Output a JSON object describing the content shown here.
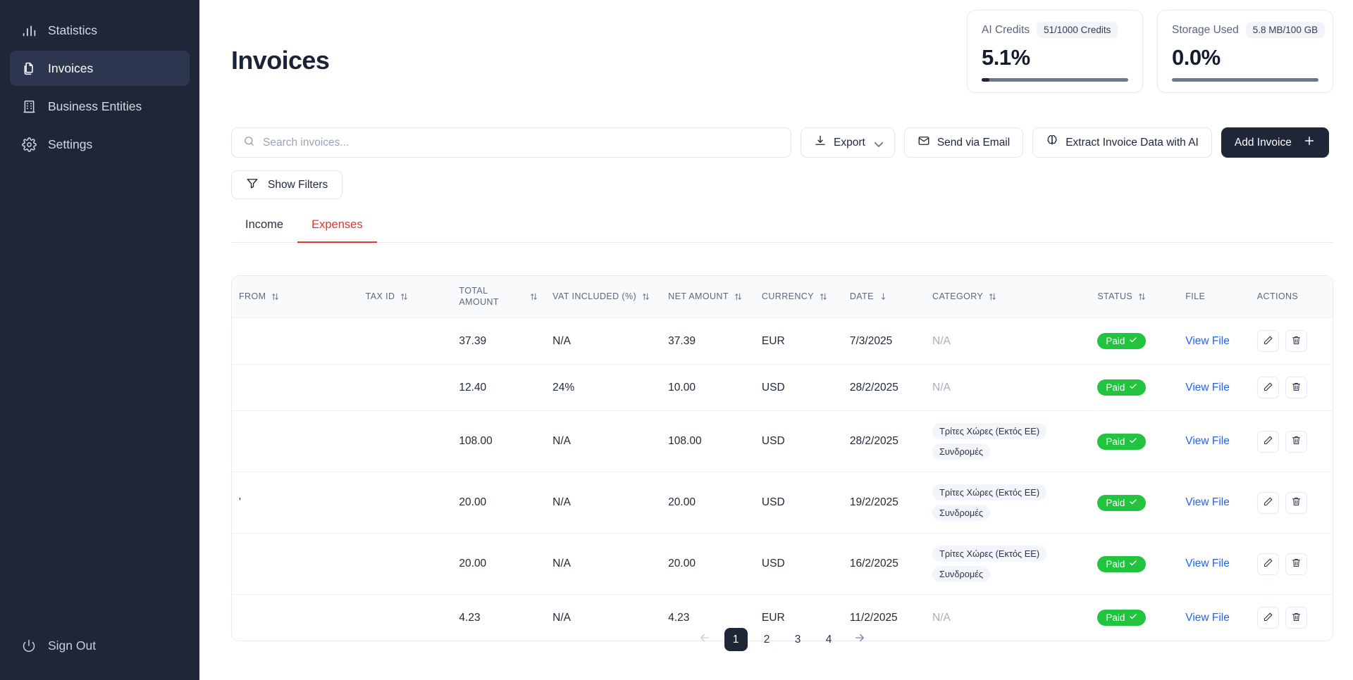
{
  "sidebar": {
    "items": [
      {
        "label": "Statistics",
        "icon": "bar-chart-icon",
        "active": false
      },
      {
        "label": "Invoices",
        "icon": "documents-icon",
        "active": true
      },
      {
        "label": "Business Entities",
        "icon": "building-icon",
        "active": false
      },
      {
        "label": "Settings",
        "icon": "gear-icon",
        "active": false
      }
    ],
    "sign_out": {
      "label": "Sign Out",
      "icon": "power-icon"
    }
  },
  "cards": [
    {
      "label": "AI Credits",
      "pill": "51/1000 Credits",
      "value": "5.1%",
      "percent": 5.1,
      "fill_color": "#1e2637",
      "track_color": "#6d7789"
    },
    {
      "label": "Storage Used",
      "pill": "5.8 MB/100 GB",
      "value": "0.0%",
      "percent": 0.0,
      "fill_color": "#1e2637",
      "track_color": "#6d7789"
    }
  ],
  "page": {
    "title": "Invoices"
  },
  "search": {
    "placeholder": "Search invoices...",
    "value": "",
    "icon": "search-icon"
  },
  "toolbar": {
    "export_label": "Export",
    "export_icon": "download-icon",
    "send_email_label": "Send via Email",
    "send_email_icon": "envelope-icon",
    "extract_label": "Extract Invoice Data with AI",
    "extract_icon": "brain-icon",
    "add_invoice_label": "Add Invoice",
    "add_invoice_icon": "plus-icon",
    "show_filters_label": "Show Filters",
    "show_filters_icon": "funnel-icon"
  },
  "tabs": [
    {
      "label": "Income",
      "active": false
    },
    {
      "label": "Expenses",
      "active": true
    }
  ],
  "table": {
    "columns": [
      {
        "label": "FROM",
        "sort": "both"
      },
      {
        "label": "TAX ID",
        "sort": "both"
      },
      {
        "label": "TOTAL AMOUNT",
        "sort": "both"
      },
      {
        "label": "VAT INCLUDED (%)",
        "sort": "both"
      },
      {
        "label": "NET AMOUNT",
        "sort": "both"
      },
      {
        "label": "CURRENCY",
        "sort": "both"
      },
      {
        "label": "DATE",
        "sort": "desc"
      },
      {
        "label": "CATEGORY",
        "sort": "both"
      },
      {
        "label": "STATUS",
        "sort": "both"
      },
      {
        "label": "FILE",
        "sort": "none"
      },
      {
        "label": "ACTIONS",
        "sort": "none"
      }
    ],
    "rows": [
      {
        "from": "",
        "tax_id": "",
        "total_amount": "37.39",
        "vat_included": "N/A",
        "net_amount": "37.39",
        "currency": "EUR",
        "date": "7/3/2025",
        "categories": [],
        "category_na": "N/A",
        "status": "Paid",
        "file_label": "View File"
      },
      {
        "from": "",
        "tax_id": "",
        "total_amount": "12.40",
        "vat_included": "24%",
        "net_amount": "10.00",
        "currency": "USD",
        "date": "28/2/2025",
        "categories": [],
        "category_na": "N/A",
        "status": "Paid",
        "file_label": "View File"
      },
      {
        "from": "",
        "tax_id": "",
        "total_amount": "108.00",
        "vat_included": "N/A",
        "net_amount": "108.00",
        "currency": "USD",
        "date": "28/2/2025",
        "categories": [
          "Τρίτες Χώρες (Εκτός ΕΕ)",
          "Συνδρομές"
        ],
        "category_na": "",
        "status": "Paid",
        "file_label": "View File"
      },
      {
        "from": "'",
        "tax_id": "",
        "total_amount": "20.00",
        "vat_included": "N/A",
        "net_amount": "20.00",
        "currency": "USD",
        "date": "19/2/2025",
        "categories": [
          "Τρίτες Χώρες (Εκτός ΕΕ)",
          "Συνδρομές"
        ],
        "category_na": "",
        "status": "Paid",
        "file_label": "View File"
      },
      {
        "from": "",
        "tax_id": "",
        "total_amount": "20.00",
        "vat_included": "N/A",
        "net_amount": "20.00",
        "currency": "USD",
        "date": "16/2/2025",
        "categories": [
          "Τρίτες Χώρες (Εκτός ΕΕ)",
          "Συνδρομές"
        ],
        "category_na": "",
        "status": "Paid",
        "file_label": "View File"
      },
      {
        "from": "",
        "tax_id": "",
        "total_amount": "4.23",
        "vat_included": "N/A",
        "net_amount": "4.23",
        "currency": "EUR",
        "date": "11/2/2025",
        "categories": [],
        "category_na": "N/A",
        "status": "Paid",
        "file_label": "View File"
      }
    ]
  },
  "pagination": {
    "prev_icon": "arrow-left-icon",
    "next_icon": "arrow-right-icon",
    "pages": [
      "1",
      "2",
      "3",
      "4"
    ],
    "current": "1"
  },
  "colors": {
    "sidebar_bg": "#1e2637",
    "accent_tab": "#e8332a",
    "paid_green": "#22c33e",
    "link_blue": "#2563eb",
    "primary_dark": "#1e2637"
  }
}
